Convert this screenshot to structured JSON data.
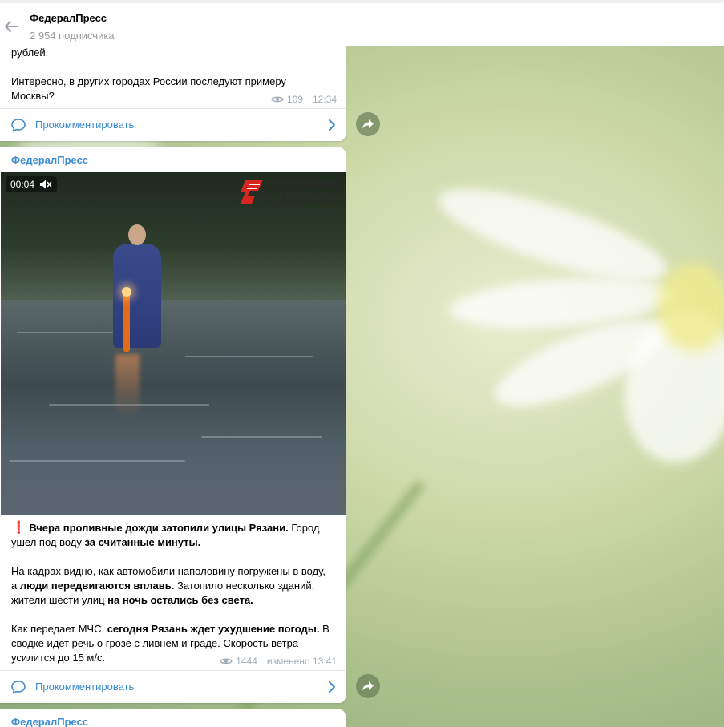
{
  "header": {
    "title": "ФедералПресс",
    "subscribers": "2 954 подписчика"
  },
  "post1": {
    "text_line1": "рублей.",
    "text_p2": "Интересно, в других городах России последуют примеру Москвы?",
    "views": "109",
    "time": "12:34",
    "comment_label": "Прокомментировать"
  },
  "post2": {
    "sender": "ФедералПресс",
    "video_time": "00:04",
    "video_logo": {
      "line1": "ФЕДЕРАЛ",
      "line2": "ПРЕСС"
    },
    "exclaim": "❗",
    "p1_bold1": "Вчера проливные дожди затопили улицы Рязани.",
    "p1_text1": " Город ушел под воду ",
    "p1_bold2": "за считанные минуты.",
    "p2_text1": "На кадрах видно, как автомобили наполовину погружены в воду, а ",
    "p2_bold1": "люди передвигаются вплавь.",
    "p2_text2": " Затопило несколько зданий, жители шести улиц ",
    "p2_bold2": "на ночь остались без света.",
    "p3_text1": "Как передает МЧС, ",
    "p3_bold1": "сегодня Рязань ждет ухудшение погоды.",
    "p3_text2": " В сводке идет речь о грозе с ливнем и граде. Скорость ветра усилится до 15 м/с.",
    "views": "1444",
    "edited_time": "изменено 13:41",
    "comment_label": "Прокомментировать"
  },
  "post3": {
    "sender": "ФедералПресс"
  },
  "colors": {
    "link": "#3a8bd1",
    "meta": "#a0acb6",
    "accent_red": "#e0241b"
  }
}
